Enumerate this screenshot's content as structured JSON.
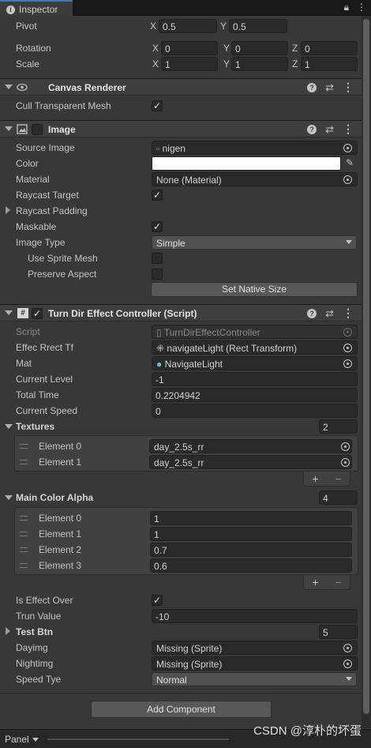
{
  "tab": {
    "title": "Inspector"
  },
  "rect": {
    "pivot": {
      "label": "Pivot",
      "x": "0.5",
      "y": "0.5"
    },
    "rotation": {
      "label": "Rotation",
      "x": "0",
      "y": "0",
      "z": "0"
    },
    "scale": {
      "label": "Scale",
      "x": "1",
      "y": "1",
      "z": "1"
    },
    "axes": {
      "x": "X",
      "y": "Y",
      "z": "Z"
    }
  },
  "canvas_renderer": {
    "title": "Canvas Renderer",
    "cull_label": "Cull Transparent Mesh",
    "cull_checked": true
  },
  "image": {
    "title": "Image",
    "source_label": "Source Image",
    "source_value": "nigen",
    "color_label": "Color",
    "color_value": "#ffffff",
    "material_label": "Material",
    "material_value": "None (Material)",
    "raycast_target_label": "Raycast Target",
    "raycast_padding_label": "Raycast Padding",
    "maskable_label": "Maskable",
    "image_type_label": "Image Type",
    "image_type_value": "Simple",
    "use_sprite_mesh_label": "Use Sprite Mesh",
    "preserve_aspect_label": "Preserve Aspect",
    "set_native_size": "Set Native Size"
  },
  "script": {
    "title": "Turn Dir Effect Controller (Script)",
    "script_label": "Script",
    "script_value": "TurnDirEffectController",
    "effec_label": "Effec Rrect Tf",
    "effec_value": "navigateLight (Rect Transform)",
    "mat_label": "Mat",
    "mat_value": "NavigateLight",
    "current_level_label": "Current Level",
    "current_level_value": "-1",
    "total_time_label": "Total Time",
    "total_time_value": "0.2204942",
    "current_speed_label": "Current Speed",
    "current_speed_value": "0",
    "textures": {
      "label": "Textures",
      "count": "2",
      "items": [
        {
          "label": "Element 0",
          "value": "day_2.5s_rr"
        },
        {
          "label": "Element 1",
          "value": "day_2.5s_rr"
        }
      ]
    },
    "main_color_alpha": {
      "label": "Main Color Alpha",
      "count": "4",
      "items": [
        {
          "label": "Element 0",
          "value": "1"
        },
        {
          "label": "Element 1",
          "value": "1"
        },
        {
          "label": "Element 2",
          "value": "0.7"
        },
        {
          "label": "Element 3",
          "value": "0.6"
        }
      ]
    },
    "is_effect_over_label": "Is Effect Over",
    "trun_value_label": "Trun Value",
    "trun_value_value": "-10",
    "test_btn_label": "Test Btn",
    "test_btn_count": "5",
    "dayimg_label": "Dayimg",
    "dayimg_value": "Missing (Sprite)",
    "nightimg_label": "Nightimg",
    "nightimg_value": "Missing (Sprite)",
    "speed_tye_label": "Speed Tye",
    "speed_tye_value": "Normal"
  },
  "list_footer": {
    "plus": "+",
    "minus": "−"
  },
  "add_component": "Add Component",
  "bottom": {
    "panel_label": "Panel"
  },
  "watermark": "CSDN @淳朴的坏蛋"
}
